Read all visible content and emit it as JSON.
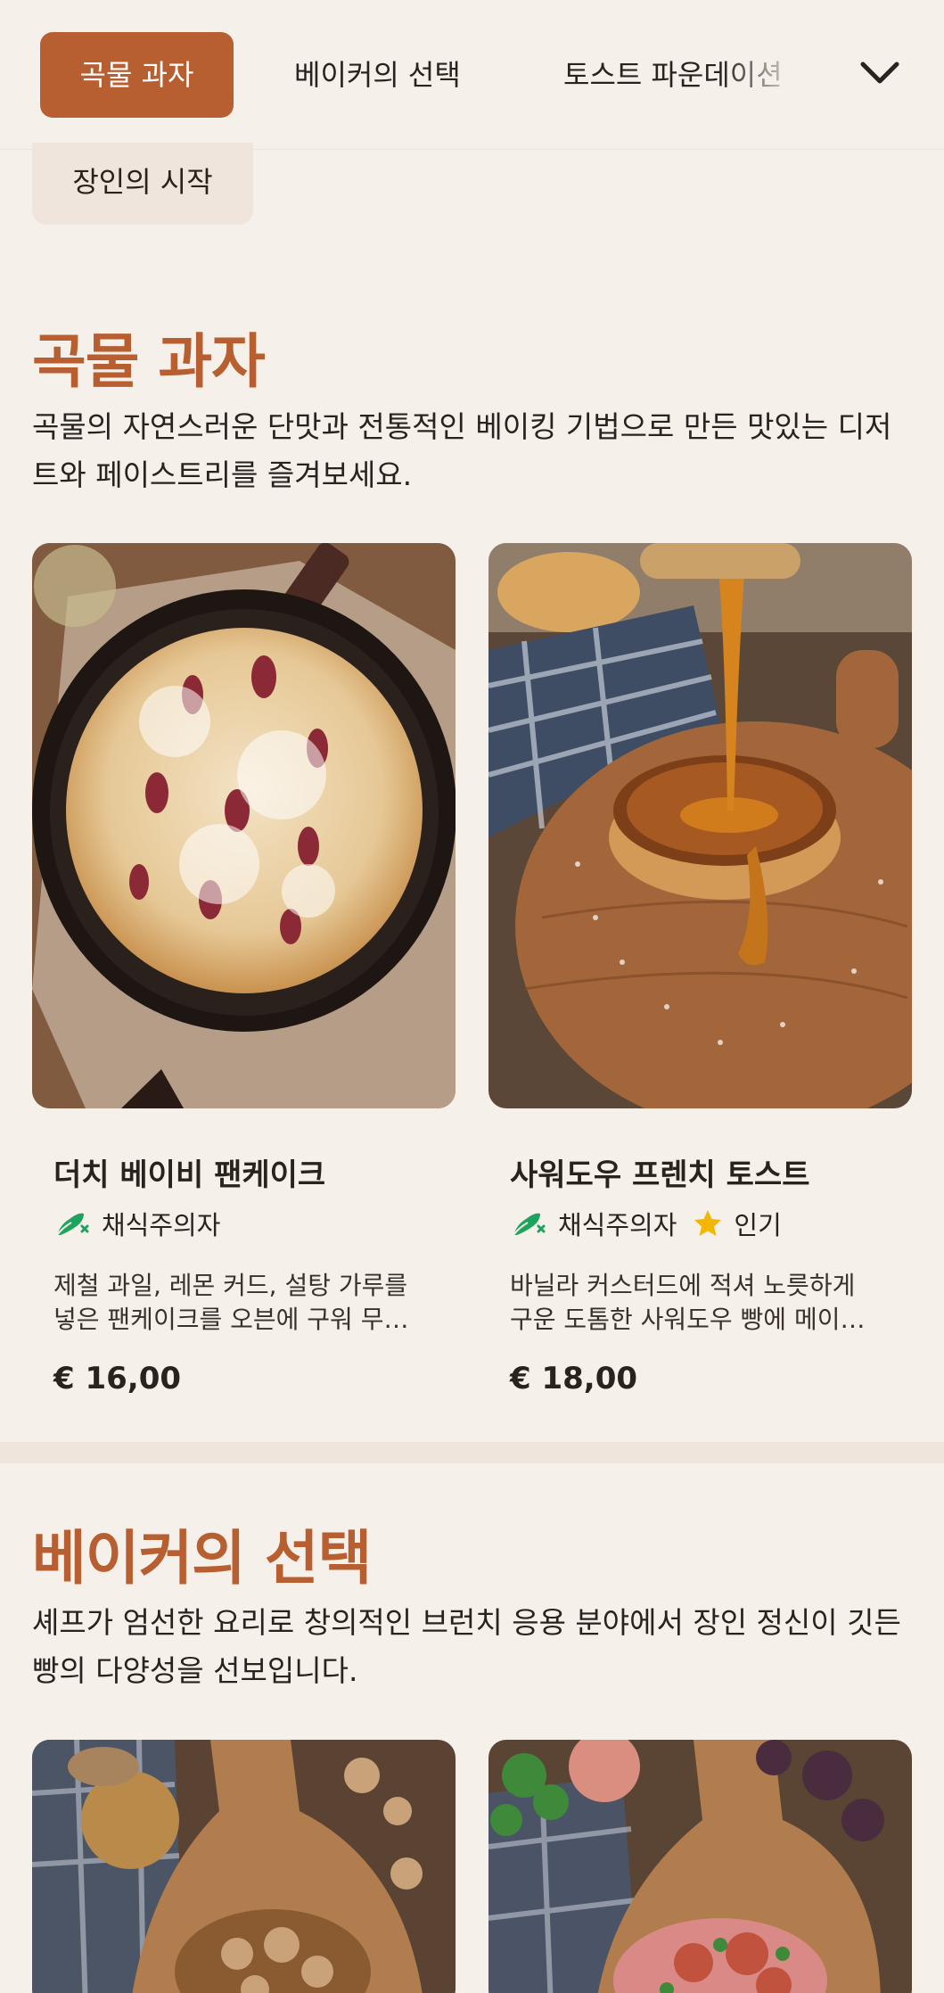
{
  "nav": {
    "tabs": [
      {
        "label": "곡물 과자",
        "active": true
      },
      {
        "label": "베이커의 선택",
        "active": false
      },
      {
        "label": "토스트 파운데이션",
        "active": false
      },
      {
        "label": "장인의 시작",
        "active": false
      }
    ],
    "expand_icon": "chevron-down-icon"
  },
  "sections": [
    {
      "title": "곡물 과자",
      "description": "곡물의 자연스러운 단맛과 전통적인 베이킹 기법으로 만든 맛있는 디저트와 페이스트리를 즐겨보세요.",
      "items": [
        {
          "name": "더치 베이비 팬케이크",
          "tags": [
            {
              "label": "채식주의자",
              "icon": "vegetarian-icon"
            }
          ],
          "description": "제철 과일, 레몬 커드, 설탕 가루를 넣은 팬케이크를 오븐에 구워 무쇠 팬에 담아 제공합니다.",
          "price": "€ 16,00"
        },
        {
          "name": "사워도우 프렌치 토스트",
          "tags": [
            {
              "label": "채식주의자",
              "icon": "vegetarian-icon"
            },
            {
              "label": "인기",
              "icon": "star-icon"
            }
          ],
          "description": "바닐라 커스터드에 적셔 노릇하게 구운 도톰한 사워도우 빵에 메이플 시럽을 곁들였습니다.",
          "price": "€ 18,00"
        }
      ]
    },
    {
      "title": "베이커의 선택",
      "description": "셰프가 엄선한 요리로 창의적인 브런치 응용 분야에서 장인 정신이 깃든 빵의 다양성을 선보입니다."
    }
  ],
  "colors": {
    "accent": "#b85f32",
    "background": "#f6f0eb",
    "vegetarian": "#1fa35c",
    "star": "#f2b705"
  }
}
